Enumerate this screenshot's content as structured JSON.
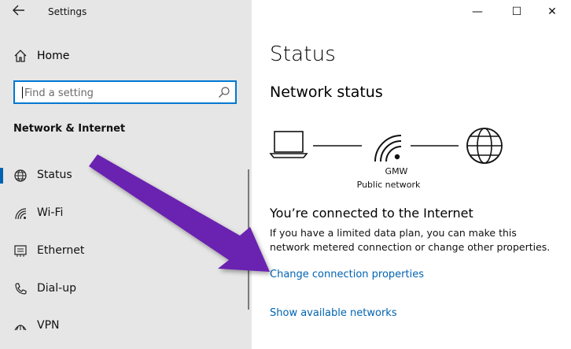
{
  "window": {
    "title": "Settings",
    "back_icon": "back-arrow-icon",
    "minimize_glyph": "—",
    "maximize_glyph": "☐",
    "close_glyph": "✕"
  },
  "sidebar": {
    "home_label": "Home",
    "search_placeholder": "Find a setting",
    "section_title": "Network & Internet",
    "items": [
      {
        "label": "Status",
        "icon": "status-globe-icon",
        "selected": true
      },
      {
        "label": "Wi-Fi",
        "icon": "wifi-icon",
        "selected": false
      },
      {
        "label": "Ethernet",
        "icon": "ethernet-icon",
        "selected": false
      },
      {
        "label": "Dial-up",
        "icon": "dialup-icon",
        "selected": false
      },
      {
        "label": "VPN",
        "icon": "vpn-icon",
        "selected": false
      }
    ]
  },
  "main": {
    "title": "Status",
    "network_status_heading": "Network status",
    "network": {
      "name": "GMW",
      "type": "Public network"
    },
    "connected_heading": "You’re connected to the Internet",
    "description": "If you have a limited data plan, you can make this network metered connection or change other properties.",
    "links": {
      "change_properties": "Change connection properties",
      "show_networks": "Show available networks"
    }
  },
  "colors": {
    "accent": "#0078d4",
    "link": "#0063b1",
    "sidebar_bg": "#e6e6e6",
    "annotation_arrow": "#6a22b0"
  }
}
